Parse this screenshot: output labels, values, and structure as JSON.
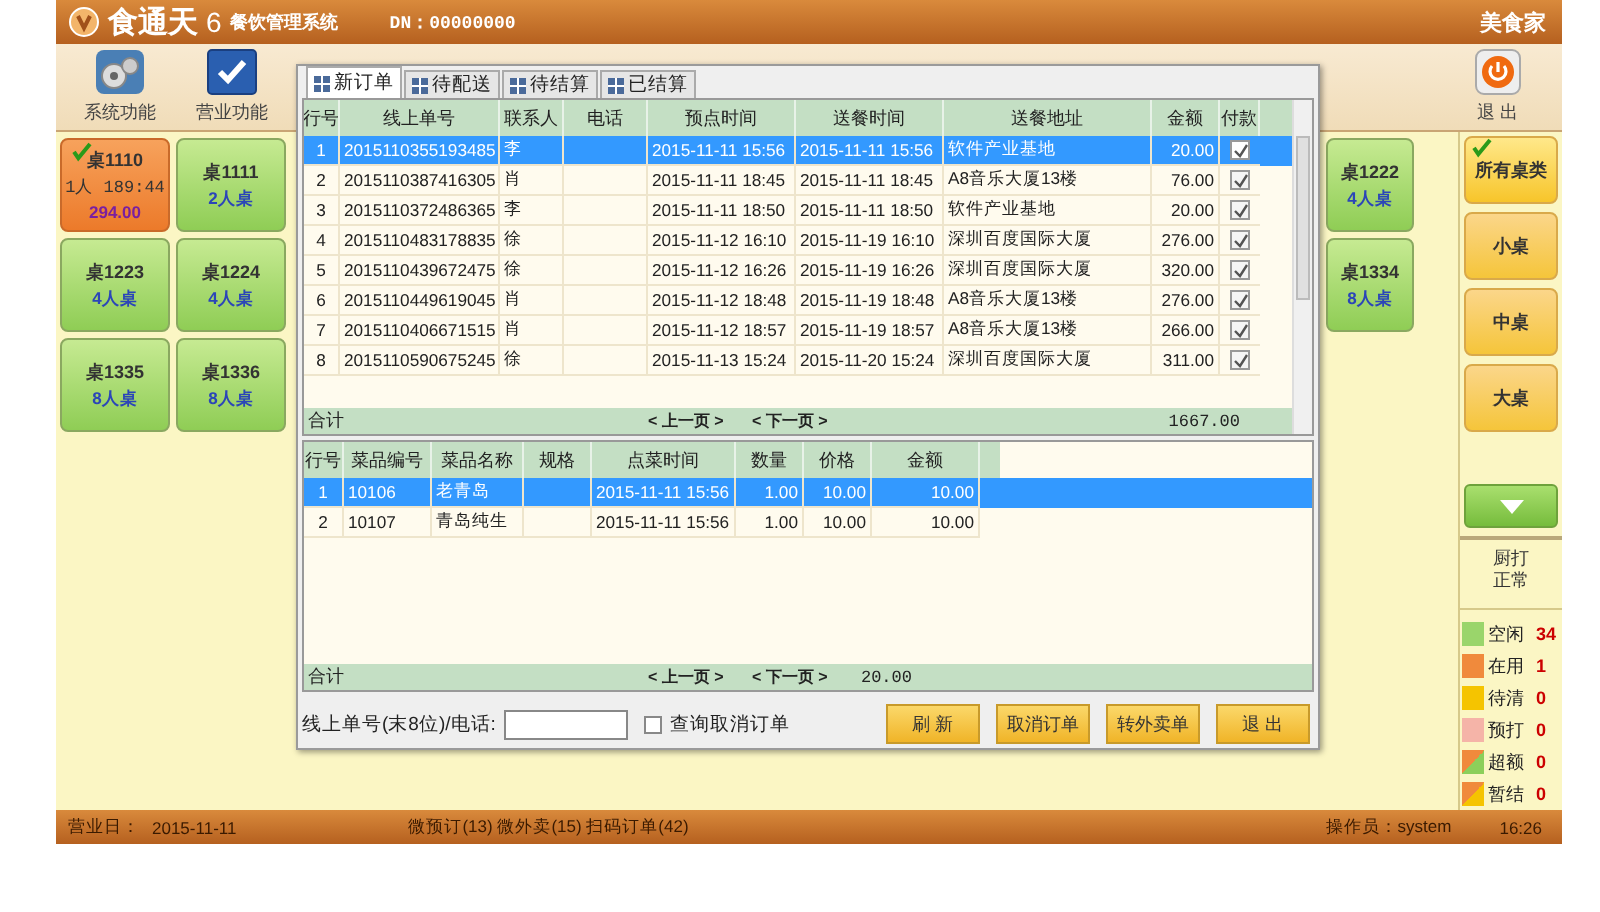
{
  "title_bar": {
    "logo": "食通天",
    "version": "6",
    "subtitle": "餐饮管理系统",
    "dn": "DN：00000000",
    "brand": "美食家"
  },
  "toolbar": [
    {
      "label": "系统功能"
    },
    {
      "label": "营业功能"
    }
  ],
  "exit_button": {
    "label": "退 出"
  },
  "tables_left": [
    {
      "name": "桌1110",
      "kind": "busy",
      "checked": true,
      "lines": [
        "1人 189:44"
      ],
      "amount": "294.00"
    },
    {
      "name": "桌1111",
      "kind": "free",
      "checked": false,
      "amount": "2人桌"
    },
    {
      "name": "桌1223",
      "kind": "free",
      "checked": false,
      "amount": "4人桌"
    },
    {
      "name": "桌1224",
      "kind": "free",
      "checked": false,
      "amount": "4人桌"
    },
    {
      "name": "桌1335",
      "kind": "free",
      "checked": false,
      "amount": "8人桌"
    },
    {
      "name": "桌1336",
      "kind": "free",
      "checked": false,
      "amount": "8人桌"
    }
  ],
  "tables_right": [
    {
      "name": "桌1222",
      "kind": "free",
      "checked": false,
      "amount": "4人桌"
    },
    {
      "name": "桌1334",
      "kind": "free",
      "checked": false,
      "amount": "8人桌"
    }
  ],
  "categories": [
    {
      "label": "所有桌类",
      "selected": true
    },
    {
      "label": "小桌",
      "selected": false
    },
    {
      "label": "中桌",
      "selected": false
    },
    {
      "label": "大桌",
      "selected": false
    }
  ],
  "printer_status": [
    "厨打",
    "正常"
  ],
  "legend": [
    {
      "label": "空闲",
      "count": "34",
      "kind": "solid",
      "color": "#9ad56b"
    },
    {
      "label": "在用",
      "count": "1",
      "kind": "solid",
      "color": "#f08a3c"
    },
    {
      "label": "待清",
      "count": "0",
      "kind": "solid",
      "color": "#f5c400"
    },
    {
      "label": "预打",
      "count": "0",
      "kind": "solid",
      "color": "#f5b4a8"
    },
    {
      "label": "超额",
      "count": "0",
      "kind": "split",
      "color": "#8ccf5a"
    },
    {
      "label": "暂结",
      "count": "0",
      "kind": "split",
      "color": "#f5c400"
    }
  ],
  "dialog": {
    "tabs": [
      {
        "label": "新订单",
        "selected": true
      },
      {
        "label": "待配送",
        "selected": false
      },
      {
        "label": "待结算",
        "selected": false
      },
      {
        "label": "已结算",
        "selected": false
      }
    ],
    "orders": {
      "columns": [
        "行号",
        "线上单号",
        "联系人",
        "电话",
        "预点时间",
        "送餐时间",
        "送餐地址",
        "金额",
        "付款"
      ],
      "rows": [
        {
          "cells": [
            "1",
            "2015110355193485",
            "李",
            "",
            "2015-11-11 15:56",
            "2015-11-11 15:56",
            "软件产业基地",
            "20.00"
          ],
          "paid": true,
          "selected": true
        },
        {
          "cells": [
            "2",
            "2015110387416305",
            "肖",
            "",
            "2015-11-11 18:45",
            "2015-11-11 18:45",
            "A8音乐大厦13楼",
            "76.00"
          ],
          "paid": true,
          "selected": false
        },
        {
          "cells": [
            "3",
            "2015110372486365",
            "李",
            "",
            "2015-11-11 18:50",
            "2015-11-11 18:50",
            "软件产业基地",
            "20.00"
          ],
          "paid": true,
          "selected": false
        },
        {
          "cells": [
            "4",
            "2015110483178835",
            "徐",
            "",
            "2015-11-12 16:10",
            "2015-11-19 16:10",
            "深圳百度国际大厦",
            "276.00"
          ],
          "paid": true,
          "selected": false
        },
        {
          "cells": [
            "5",
            "2015110439672475",
            "徐",
            "",
            "2015-11-12 16:26",
            "2015-11-19 16:26",
            "深圳百度国际大厦",
            "320.00"
          ],
          "paid": true,
          "selected": false
        },
        {
          "cells": [
            "6",
            "2015110449619045",
            "肖",
            "",
            "2015-11-12 18:48",
            "2015-11-19 18:48",
            "A8音乐大厦13楼",
            "276.00"
          ],
          "paid": true,
          "selected": false
        },
        {
          "cells": [
            "7",
            "2015110406671515",
            "肖",
            "",
            "2015-11-12 18:57",
            "2015-11-19 18:57",
            "A8音乐大厦13楼",
            "266.00"
          ],
          "paid": true,
          "selected": false
        },
        {
          "cells": [
            "8",
            "2015110590675245",
            "徐",
            "",
            "2015-11-13 15:24",
            "2015-11-20 15:24",
            "深圳百度国际大厦",
            "311.00"
          ],
          "paid": true,
          "selected": false
        }
      ],
      "footer": {
        "label": "合计",
        "prev": "< 上一页 >",
        "next": "< 下一页 >",
        "total": "1667.00"
      }
    },
    "items": {
      "columns": [
        "行号",
        "菜品编号",
        "菜品名称",
        "规格",
        "点菜时间",
        "数量",
        "价格",
        "金额"
      ],
      "rows": [
        {
          "cells": [
            "1",
            "10106",
            "老青岛",
            "",
            "2015-11-11 15:56",
            "1.00",
            "10.00",
            "10.00"
          ],
          "selected": true
        },
        {
          "cells": [
            "2",
            "10107",
            "青岛纯生",
            "",
            "2015-11-11 15:56",
            "1.00",
            "10.00",
            "10.00"
          ],
          "selected": false
        }
      ],
      "footer": {
        "label": "合计",
        "prev": "< 上一页 >",
        "next": "< 下一页 >",
        "total": "20.00"
      }
    },
    "search": {
      "label": "线上单号(末8位)/电话:"
    },
    "cancel_filter": {
      "label": "查询取消订单",
      "checked": false
    },
    "buttons": [
      "刷 新",
      "取消订单",
      "转外卖单",
      "退 出"
    ]
  },
  "status_bar": {
    "business_day_label": "营业日：",
    "business_day": "2015-11-11",
    "counts": "微预订(13) 微外卖(15) 扫码订单(42)",
    "operator": "操作员：system",
    "time": "16:26"
  }
}
